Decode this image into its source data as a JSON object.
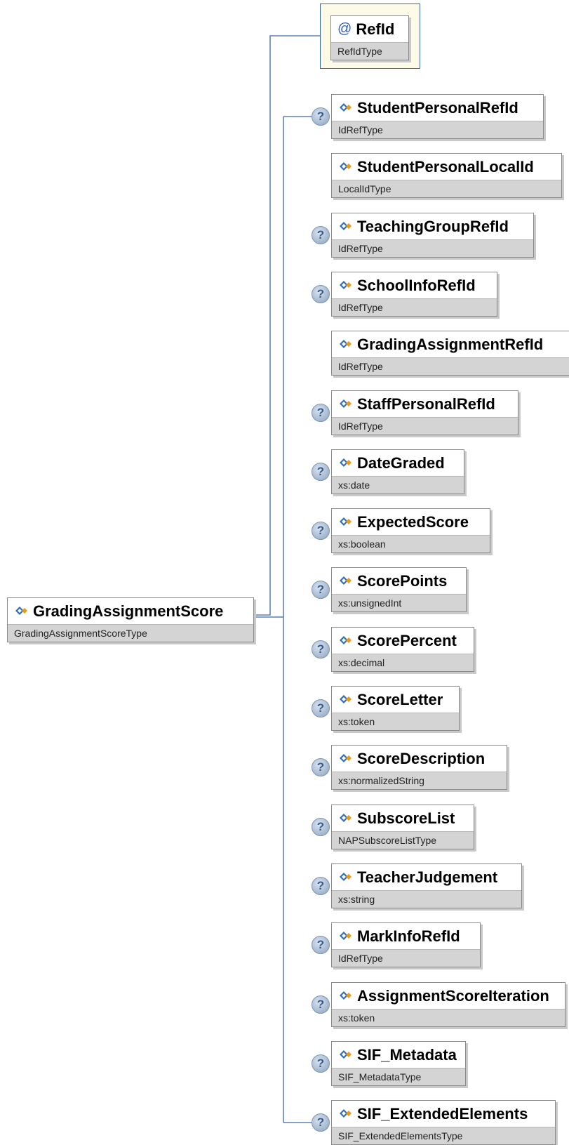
{
  "root": {
    "name": "GradingAssignmentScore",
    "type": "GradingAssignmentScoreType",
    "icon": "element-icon"
  },
  "attribute": {
    "symbol": "@",
    "name": "RefId",
    "type": "RefIdType"
  },
  "optional_marker": "?",
  "elements": [
    {
      "name": "StudentPersonalRefId",
      "type": "IdRefType",
      "optional": true
    },
    {
      "name": "StudentPersonalLocalId",
      "type": "LocalIdType",
      "optional": false
    },
    {
      "name": "TeachingGroupRefId",
      "type": "IdRefType",
      "optional": true
    },
    {
      "name": "SchoolInfoRefId",
      "type": "IdRefType",
      "optional": true
    },
    {
      "name": "GradingAssignmentRefId",
      "type": "IdRefType",
      "optional": false
    },
    {
      "name": "StaffPersonalRefId",
      "type": "IdRefType",
      "optional": true
    },
    {
      "name": "DateGraded",
      "type": "xs:date",
      "optional": true
    },
    {
      "name": "ExpectedScore",
      "type": "xs:boolean",
      "optional": true
    },
    {
      "name": "ScorePoints",
      "type": "xs:unsignedInt",
      "optional": true
    },
    {
      "name": "ScorePercent",
      "type": "xs:decimal",
      "optional": true
    },
    {
      "name": "ScoreLetter",
      "type": "xs:token",
      "optional": true
    },
    {
      "name": "ScoreDescription",
      "type": "xs:normalizedString",
      "optional": true
    },
    {
      "name": "SubscoreList",
      "type": "NAPSubscoreListType",
      "optional": true
    },
    {
      "name": "TeacherJudgement",
      "type": "xs:string",
      "optional": true
    },
    {
      "name": "MarkInfoRefId",
      "type": "IdRefType",
      "optional": true
    },
    {
      "name": "AssignmentScoreIteration",
      "type": "xs:token",
      "optional": true
    },
    {
      "name": "SIF_Metadata",
      "type": "SIF_MetadataType",
      "optional": true
    },
    {
      "name": "SIF_ExtendedElements",
      "type": "SIF_ExtendedElementsType",
      "optional": true
    }
  ],
  "colors": {
    "connector": "#3b66a6",
    "icon_blue": "#2f6db5",
    "icon_orange": "#e89a1c",
    "type_band": "#d4d4d4"
  }
}
